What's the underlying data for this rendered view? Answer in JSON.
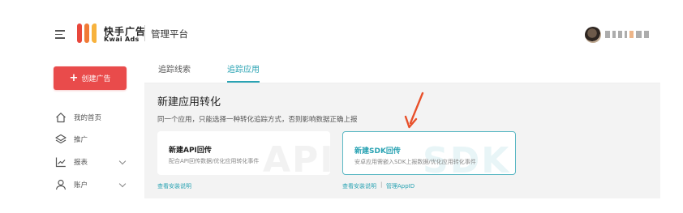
{
  "header": {
    "brand_cn": "快手广告",
    "brand_en": "Kwai Ads",
    "platform": "管理平台"
  },
  "sidebar": {
    "create_label": "创建广告",
    "items": [
      {
        "label": "我的首页",
        "icon": "home-icon"
      },
      {
        "label": "推广",
        "icon": "layers-icon"
      },
      {
        "label": "报表",
        "icon": "chart-icon"
      },
      {
        "label": "账户",
        "icon": "user-icon"
      }
    ]
  },
  "tabs": [
    {
      "label": "追踪线索",
      "active": false
    },
    {
      "label": "追踪应用",
      "active": true
    }
  ],
  "panel": {
    "title": "新建应用转化",
    "description": "同一个应用，只能选择一种转化追踪方式，否则影响数据正确上报"
  },
  "cards": [
    {
      "title": "新建API回传",
      "desc": "配合API回传数据/优化应用转化事件",
      "watermark": "API"
    },
    {
      "title": "新建SDK回传",
      "desc": "安卓应用需嵌入SDK上报数据/优化应用转化事件",
      "watermark": "SDK"
    }
  ],
  "links": {
    "api_guide": "查看安装说明",
    "sdk_guide": "查看安装说明",
    "separator": "|",
    "manage_appid": "管理AppID"
  },
  "colors": {
    "accent": "#2aa3b3",
    "create_button": "#e94b4b",
    "arrow": "#e8502a"
  }
}
